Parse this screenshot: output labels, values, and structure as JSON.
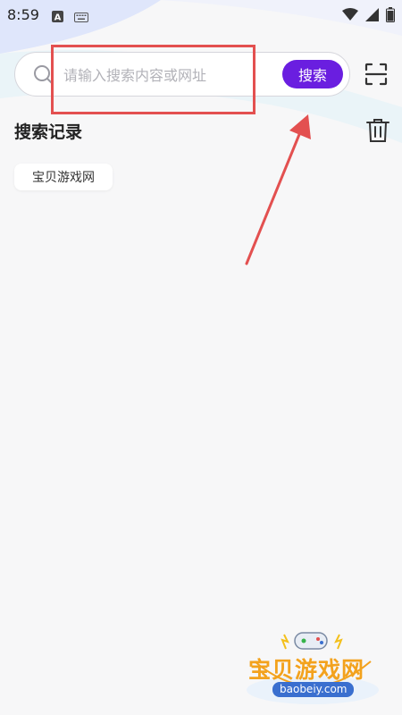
{
  "status_bar": {
    "time": "8:59",
    "left_icons": [
      "font-a-icon",
      "keyboard-icon"
    ],
    "right_icons": [
      "wifi-icon",
      "signal-icon",
      "battery-icon"
    ]
  },
  "search": {
    "placeholder": "请输入搜索内容或网址",
    "button_label": "搜索"
  },
  "history": {
    "title": "搜索记录",
    "items": [
      "宝贝游戏网"
    ]
  },
  "watermark": {
    "text": "宝贝游戏网",
    "url": "baobeiy.com"
  },
  "colors": {
    "accent": "#6a1ee0",
    "annotation": "#e35050",
    "background": "#f7f7f8"
  }
}
